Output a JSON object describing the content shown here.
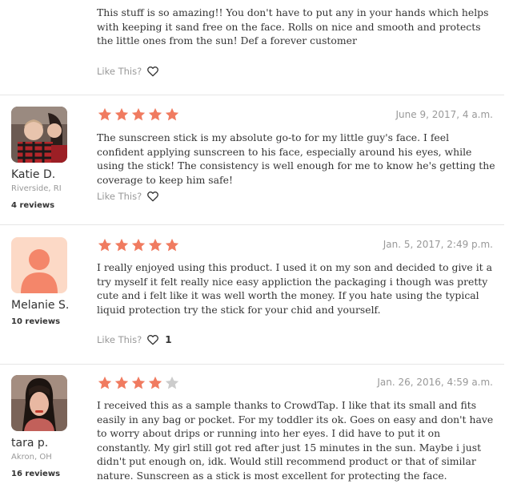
{
  "colors": {
    "star_filled": "#f07b60",
    "star_empty": "#cccccc",
    "muted_text": "#999999",
    "divider": "#e6e6e6"
  },
  "reviews": [
    {
      "text": "This stuff is so amazing!! You don't have to put any in your hands which helps with keeping it sand free on the face. Rolls on nice and smooth and protects the little ones from the sun! Def a forever customer",
      "like_label": "Like This?"
    },
    {
      "user_name": "Katie D.",
      "user_location": "Riverside, RI",
      "user_reviews": "4 reviews",
      "rating": 5,
      "date": "June 9, 2017, 4 a.m.",
      "text": "The sunscreen stick is my absolute go-to for my little guy's face. I feel confident applying sunscreen to his face, especially around his eyes, while using the stick! The consistency is well enough for me to know he's getting the coverage to keep him safe!",
      "like_label": "Like This?"
    },
    {
      "user_name": "Melanie S.",
      "user_reviews": "10 reviews",
      "rating": 5,
      "date": "Jan. 5, 2017, 2:49 p.m.",
      "text": "I really enjoyed using this product. I used it on my son and decided to give it a try myself it felt really nice easy appliction the packaging i though was pretty cute and i felt like it was well worth the money. If you hate using the typical liquid protection try the stick for your chid and yourself.",
      "like_label": "Like This?",
      "like_count": "1"
    },
    {
      "user_name": "tara p.",
      "user_location": "Akron, OH",
      "user_reviews": "16 reviews",
      "rating": 4,
      "date": "Jan. 26, 2016, 4:59 a.m.",
      "text": "I received this as a sample thanks to CrowdTap. I like that its small and fits easily in any bag or pocket. For my toddler its ok. Goes on easy and don't have to worry about drips or running into her eyes. I did have to put it on constantly. My girl still got red after just 15 minutes in the sun. Maybe i just didn't put enough on, idk. Would still recommend product or that of similar nature. Sunscreen as a stick is most excellent for protecting the face."
    }
  ]
}
